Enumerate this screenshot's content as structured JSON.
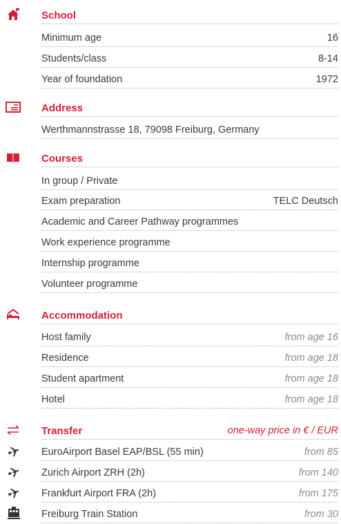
{
  "colors": {
    "accent": "#d21f34",
    "text": "#3a3a3a",
    "muted": "#8a8a8a"
  },
  "school": {
    "icon": "house-icon",
    "title": "School",
    "rows": [
      {
        "label": "Minimum age",
        "value": "16"
      },
      {
        "label": "Students/class",
        "value": "8-14"
      },
      {
        "label": "Year of foundation",
        "value": "1972"
      }
    ]
  },
  "address": {
    "icon": "envelope-icon",
    "title": "Address",
    "rows": [
      {
        "label": "Werthmannstrasse 18, 79098 Freiburg, Germany"
      }
    ]
  },
  "courses": {
    "icon": "book-icon",
    "title": "Courses",
    "rows": [
      {
        "label": "In group / Private"
      },
      {
        "label": "Exam preparation",
        "value": "TELC Deutsch"
      },
      {
        "label": "Academic and Career Pathway programmes"
      },
      {
        "label": "Work experience programme"
      },
      {
        "label": "Internship programme"
      },
      {
        "label": "Volunteer programme"
      }
    ]
  },
  "accommodation": {
    "icon": "bed-icon",
    "title": "Accommodation",
    "rows": [
      {
        "label": "Host family",
        "value": "from age 16"
      },
      {
        "label": "Residence",
        "value": "from age 18"
      },
      {
        "label": "Student apartment",
        "value": "from age 18"
      },
      {
        "label": "Hotel",
        "value": "from age 18"
      }
    ]
  },
  "transfer": {
    "icon": "arrows-icon",
    "title": "Transfer",
    "note": "one-way price in € / EUR",
    "rows": [
      {
        "icon": "plane-icon",
        "label": "EuroAirport Basel EAP/BSL (55 min)",
        "value": "from 85"
      },
      {
        "icon": "plane-icon",
        "label": "Zurich Airport ZRH (2h)",
        "value": "from 140"
      },
      {
        "icon": "plane-icon",
        "label": "Frankfurt Airport FRA (2h)",
        "value": "from 175"
      },
      {
        "icon": "train-icon",
        "label": "Freiburg Train Station",
        "value": "from 30"
      }
    ]
  }
}
